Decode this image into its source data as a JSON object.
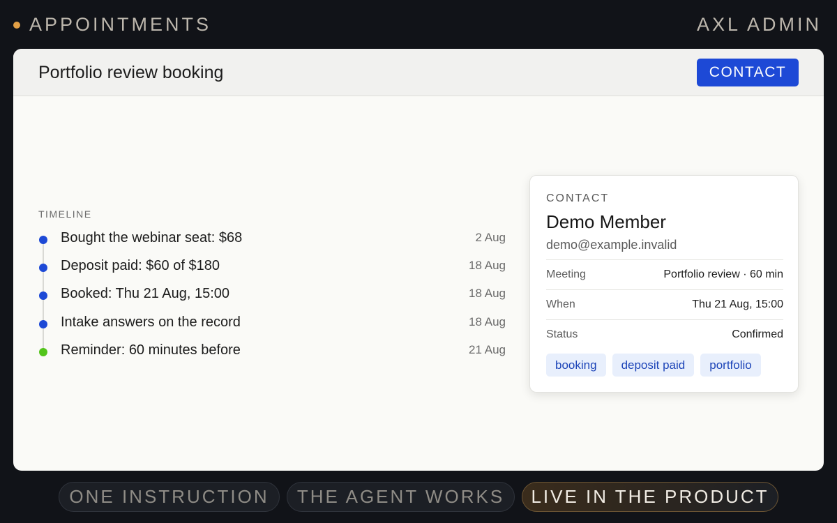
{
  "topbar": {
    "section_title": "APPOINTMENTS",
    "brand": "AXL ADMIN",
    "indicator_color": "#e2a046"
  },
  "panel": {
    "title": "Portfolio review booking",
    "contact_button_label": "CONTACT",
    "accent_color": "#1d49d6"
  },
  "timeline": {
    "label": "TIMELINE",
    "items": [
      {
        "text": "Bought the webinar seat: $68",
        "date": "2 Aug",
        "dot_color": "#1d49d6"
      },
      {
        "text": "Deposit paid: $60 of $180",
        "date": "18 Aug",
        "dot_color": "#1d49d6"
      },
      {
        "text": "Booked: Thu 21 Aug, 15:00",
        "date": "18 Aug",
        "dot_color": "#1d49d6"
      },
      {
        "text": "Intake answers on the record",
        "date": "18 Aug",
        "dot_color": "#1d49d6"
      },
      {
        "text": "Reminder: 60 minutes before",
        "date": "21 Aug",
        "dot_color": "#52c41a"
      }
    ]
  },
  "contact_card": {
    "eyebrow": "CONTACT",
    "name": "Demo Member",
    "email": "demo@example.invalid",
    "rows": [
      {
        "key": "Meeting",
        "value": "Portfolio review · 60 min"
      },
      {
        "key": "When",
        "value": "Thu 21 Aug, 15:00"
      },
      {
        "key": "Status",
        "value": "Confirmed"
      }
    ],
    "tags": [
      "booking",
      "deposit paid",
      "portfolio"
    ]
  },
  "steps": [
    {
      "label": "ONE INSTRUCTION",
      "active": false
    },
    {
      "label": "THE AGENT WORKS",
      "active": false
    },
    {
      "label": "LIVE IN THE PRODUCT",
      "active": true
    }
  ]
}
